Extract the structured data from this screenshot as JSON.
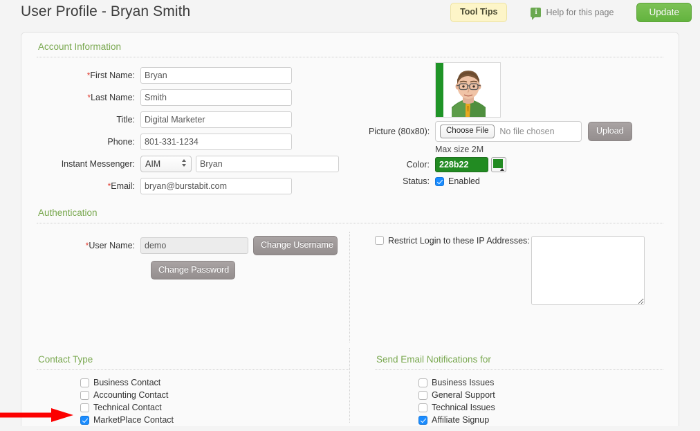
{
  "header": {
    "title": "User Profile - Bryan Smith",
    "tooltips_label": "Tool Tips",
    "help_label": "Help for this page",
    "help_icon_glyph": "i",
    "update_label": "Update"
  },
  "sections": {
    "account": "Account Information",
    "authentication": "Authentication",
    "contact_type": "Contact Type",
    "notifications": "Send Email Notifications for"
  },
  "account": {
    "fields": [
      {
        "label": "First Name:",
        "required": true,
        "value": "Bryan"
      },
      {
        "label": "Last Name:",
        "required": true,
        "value": "Smith"
      },
      {
        "label": "Title:",
        "required": false,
        "value": "Digital Marketer"
      },
      {
        "label": "Phone:",
        "required": false,
        "value": "801-331-1234"
      }
    ],
    "instant_messenger": {
      "label": "Instant Messenger:",
      "required": false,
      "selected": "AIM",
      "options": [
        "AIM"
      ],
      "handle": "Bryan"
    },
    "email": {
      "label": "Email:",
      "required": true,
      "value": "bryan@burstabit.com"
    },
    "picture": {
      "label": "Picture (80x80):",
      "choose_file_label": "Choose File",
      "no_file_text": "No file chosen",
      "upload_label": "Upload",
      "max_size_text": "Max size 2M"
    },
    "color": {
      "label": "Color:",
      "value": "228b22",
      "hex": "#228b22"
    },
    "status": {
      "label": "Status:",
      "checkbox_label": "Enabled",
      "checked": true
    }
  },
  "authentication": {
    "username": {
      "label": "User Name:",
      "required": true,
      "value": "demo"
    },
    "change_username_label": "Change Username",
    "change_password_label": "Change Password",
    "restrict_login": {
      "label": "Restrict Login to these IP Addresses:",
      "checked": false,
      "value": ""
    }
  },
  "contact_type": {
    "items": [
      {
        "label": "Business Contact",
        "checked": false
      },
      {
        "label": "Accounting Contact",
        "checked": false
      },
      {
        "label": "Technical Contact",
        "checked": false
      },
      {
        "label": "MarketPlace Contact",
        "checked": true
      }
    ]
  },
  "notifications": {
    "items": [
      {
        "label": "Business Issues",
        "checked": false
      },
      {
        "label": "General Support",
        "checked": false
      },
      {
        "label": "Technical Issues",
        "checked": false
      },
      {
        "label": "Affiliate Signup",
        "checked": true
      }
    ]
  },
  "annotation": {
    "arrow_color": "#fc0000",
    "points_to": "MarketPlace Contact"
  },
  "colors": {
    "accent_green": "#79a84f",
    "update_green": "#62b33e",
    "tooltip_yellow": "#fdf5c8",
    "required_red": "#e03b2f",
    "checkbox_blue": "#1a8cff"
  }
}
